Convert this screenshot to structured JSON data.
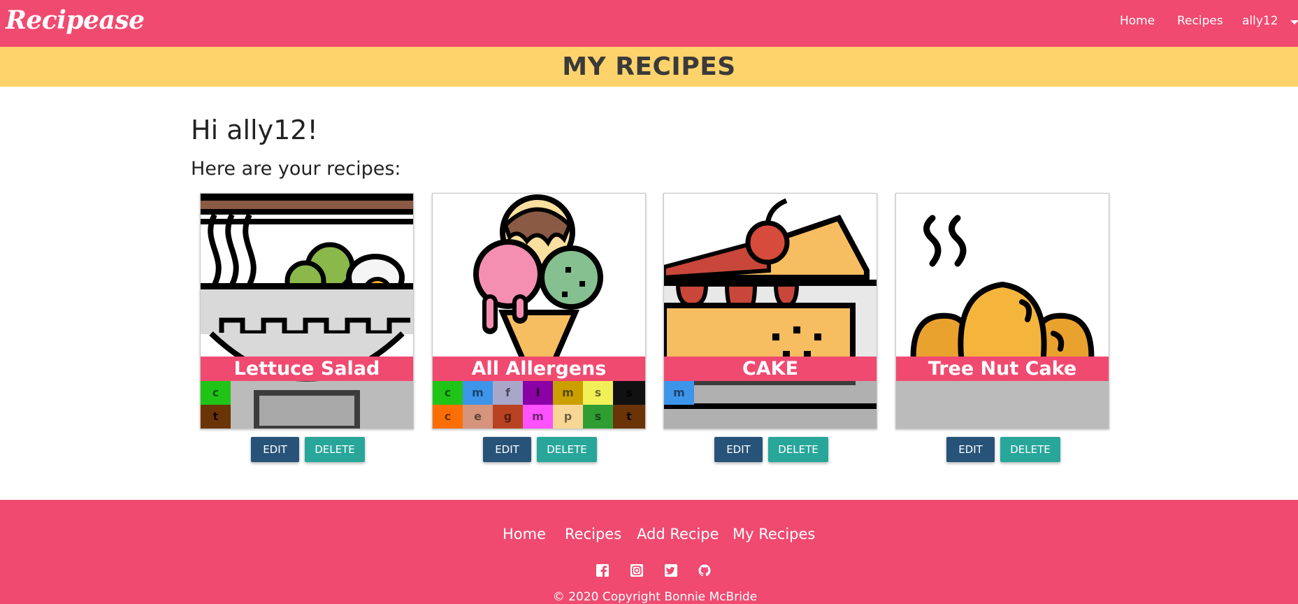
{
  "navbar": {
    "brand": "Recipease",
    "links": [
      "Home",
      "Recipes"
    ],
    "user": "ally12"
  },
  "page_title": "MY RECIPES",
  "greeting": "Hi ally12!",
  "subgreeting": "Here are your recipes:",
  "recipes": [
    {
      "title": "Lettuce Salad",
      "image": "salad-bowl-icon",
      "allergens": [
        {
          "letter": "c",
          "color": "#1fc417"
        },
        {
          "letter": "t",
          "color": "#6b3407"
        }
      ]
    },
    {
      "title": "All Allergens",
      "image": "ice-cream-icon",
      "allergens": [
        {
          "letter": "c",
          "color": "#1fc417"
        },
        {
          "letter": "m",
          "color": "#3d95ea"
        },
        {
          "letter": "f",
          "color": "#a8a7c9"
        },
        {
          "letter": "l",
          "color": "#8b00a6"
        },
        {
          "letter": "m",
          "color": "#caa000"
        },
        {
          "letter": "s",
          "color": "#f2f059"
        },
        {
          "letter": "s",
          "color": "#111111"
        },
        {
          "letter": "c",
          "color": "#fb6e06"
        },
        {
          "letter": "e",
          "color": "#d6947d"
        },
        {
          "letter": "g",
          "color": "#b84222"
        },
        {
          "letter": "m",
          "color": "#ff52ff"
        },
        {
          "letter": "p",
          "color": "#f7d696"
        },
        {
          "letter": "s",
          "color": "#2f9d32"
        },
        {
          "letter": "t",
          "color": "#6b3407"
        }
      ]
    },
    {
      "title": "CAKE",
      "image": "cake-slice-icon",
      "allergens": [
        {
          "letter": "m",
          "color": "#3d95ea"
        }
      ]
    },
    {
      "title": "Tree Nut Cake",
      "image": "croissant-icon",
      "allergens": []
    }
  ],
  "buttons": {
    "edit": "EDIT",
    "delete": "DELETE"
  },
  "footer": {
    "links": [
      "Home",
      "Recipes",
      "Add Recipe",
      "My Recipes"
    ],
    "social_icons": [
      "facebook-icon",
      "instagram-icon",
      "twitter-icon",
      "github-icon"
    ],
    "copyright": "© 2020 Copyright Bonnie McBride"
  },
  "colors": {
    "primary": "#f04a70",
    "title_bar": "#ffd36b",
    "edit_button": "#285378",
    "delete_button": "#29a69a"
  }
}
